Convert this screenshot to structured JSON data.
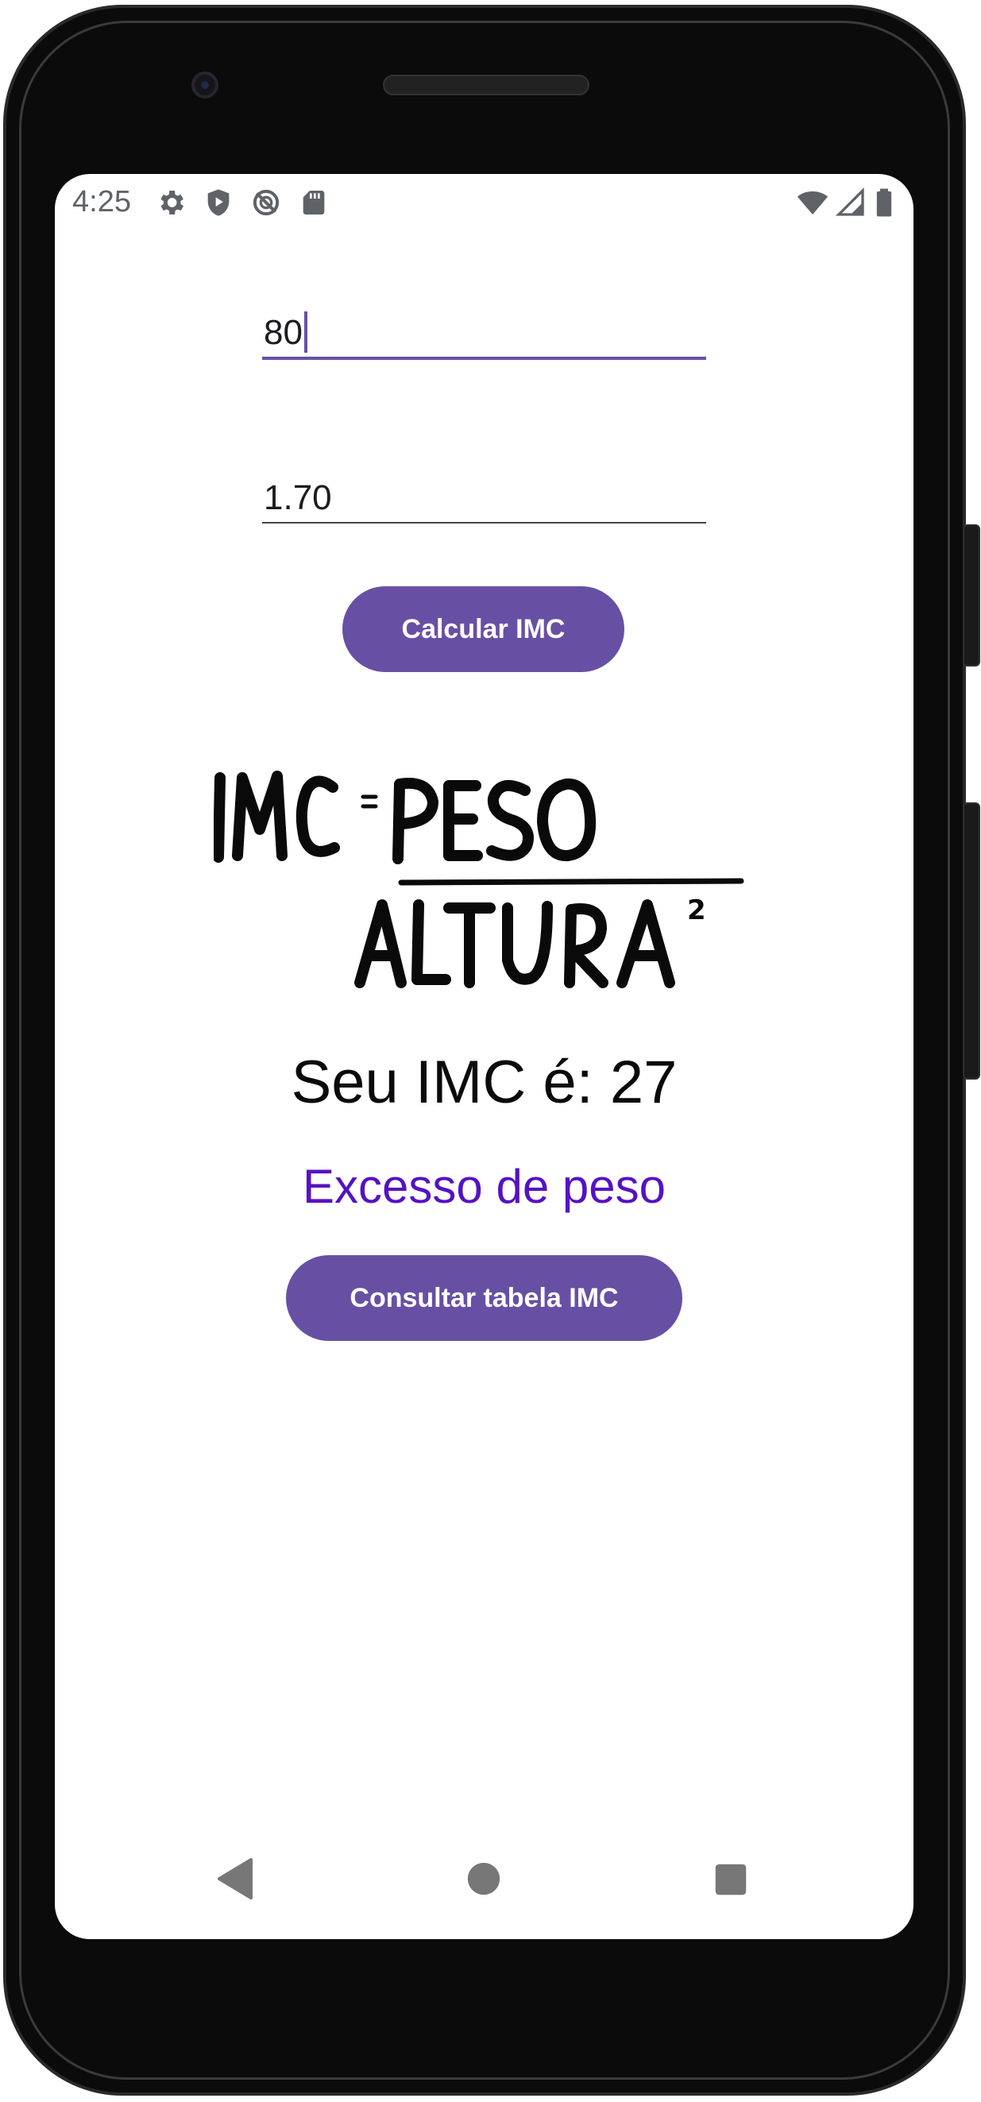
{
  "status_bar": {
    "time": "4:25",
    "left_icons": [
      "gear-icon",
      "shield-play-icon",
      "no-sync-icon",
      "sd-card-icon"
    ],
    "right_icons": [
      "wifi-icon",
      "signal-icon",
      "battery-icon"
    ]
  },
  "form": {
    "weight_value": "80",
    "height_value": "1.70",
    "calculate_button": "Calcular IMC"
  },
  "formula_image": {
    "text": "IMC = PESO / ALTURA²"
  },
  "result": {
    "imc_text": "Seu IMC é: 27",
    "category_text": "Excesso de peso",
    "category_color": "#5512c3"
  },
  "table_button": "Consultar tabela IMC",
  "nav_bar": {
    "back": "back-icon",
    "home": "home-icon",
    "recents": "recents-icon"
  },
  "colors": {
    "accent": "#6750a4"
  }
}
